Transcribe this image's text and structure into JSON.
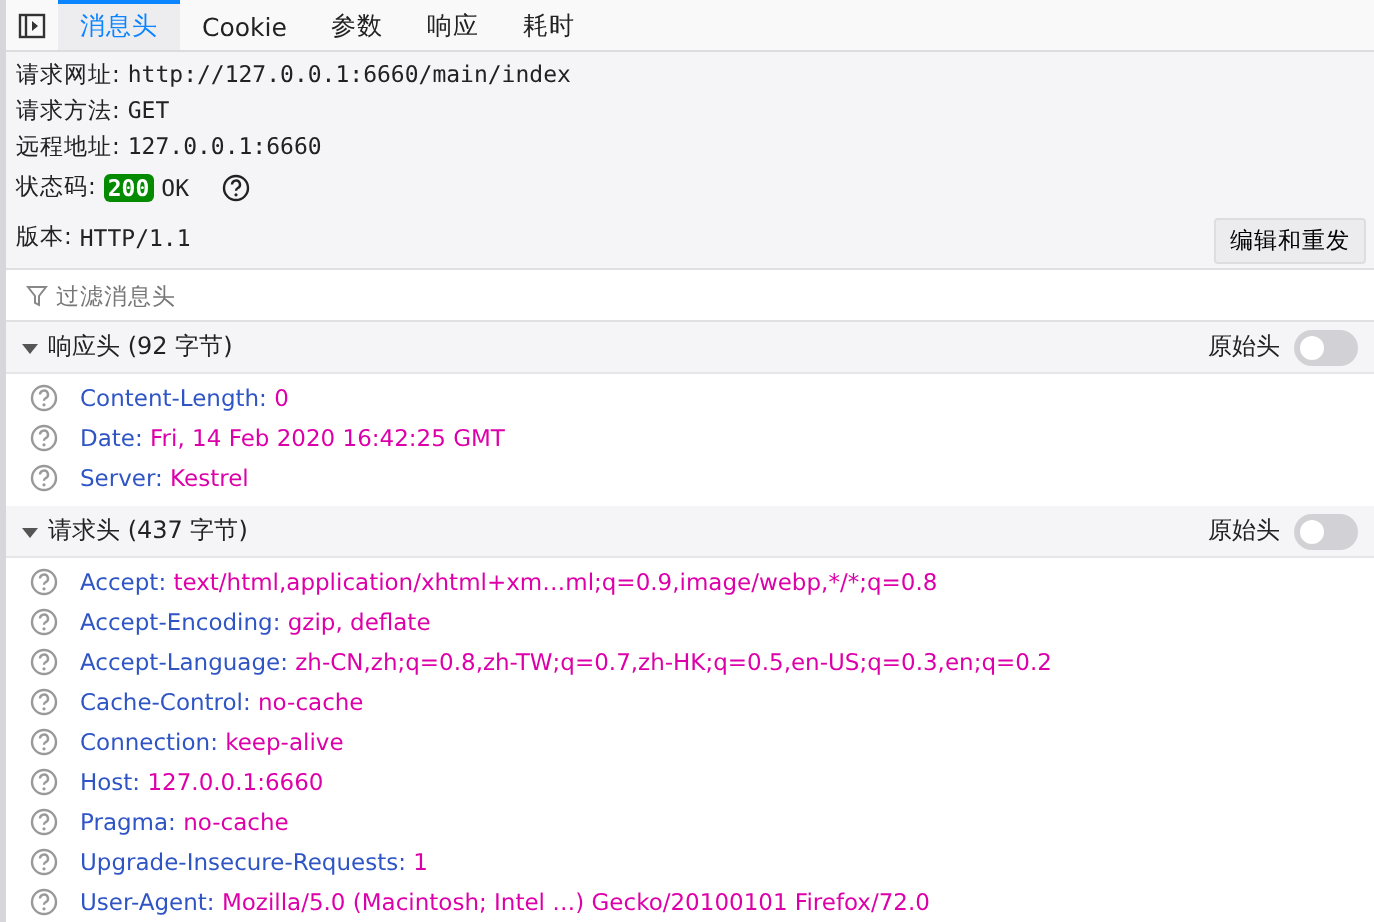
{
  "tabs": [
    {
      "label": "消息头",
      "selected": true
    },
    {
      "label": "Cookie",
      "selected": false
    },
    {
      "label": "参数",
      "selected": false
    },
    {
      "label": "响应",
      "selected": false
    },
    {
      "label": "耗时",
      "selected": false
    }
  ],
  "summary": [
    {
      "kind": "field",
      "label": "请求网址:",
      "value": "http://127.0.0.1:6660/main/index"
    },
    {
      "kind": "field",
      "label": "请求方法:",
      "value": "GET"
    },
    {
      "kind": "field",
      "label": "远程地址:",
      "value": "127.0.0.1:6660"
    },
    {
      "kind": "status",
      "label": "状态码:",
      "code": "200",
      "value": "OK"
    },
    {
      "kind": "field",
      "label": "版本:",
      "value": "HTTP/1.1"
    }
  ],
  "resend_button": "编辑和重发",
  "filter": {
    "placeholder": "过滤消息头"
  },
  "sections": [
    {
      "title": "响应头 (92 字节)",
      "expanded": true,
      "raw_label": "原始头",
      "raw_on": false,
      "headers": [
        {
          "name": "Content-Length:",
          "value": "0"
        },
        {
          "name": "Date:",
          "value": "Fri, 14 Feb 2020 16:42:25 GMT"
        },
        {
          "name": "Server:",
          "value": "Kestrel"
        }
      ]
    },
    {
      "title": "请求头 (437 字节)",
      "expanded": true,
      "raw_label": "原始头",
      "raw_on": false,
      "headers": [
        {
          "name": "Accept:",
          "value": "text/html,application/xhtml+xm…ml;q=0.9,image/webp,*/*;q=0.8"
        },
        {
          "name": "Accept-Encoding:",
          "value": "gzip, deflate"
        },
        {
          "name": "Accept-Language:",
          "value": "zh-CN,zh;q=0.8,zh-TW;q=0.7,zh-HK;q=0.5,en-US;q=0.3,en;q=0.2"
        },
        {
          "name": "Cache-Control:",
          "value": "no-cache"
        },
        {
          "name": "Connection:",
          "value": "keep-alive"
        },
        {
          "name": "Host:",
          "value": "127.0.0.1:6660"
        },
        {
          "name": "Pragma:",
          "value": "no-cache"
        },
        {
          "name": "Upgrade-Insecure-Requests:",
          "value": "1"
        },
        {
          "name": "User-Agent:",
          "value": "Mozilla/5.0 (Macintosh; Intel …) Gecko/20100101 Firefox/72.0"
        }
      ]
    }
  ]
}
